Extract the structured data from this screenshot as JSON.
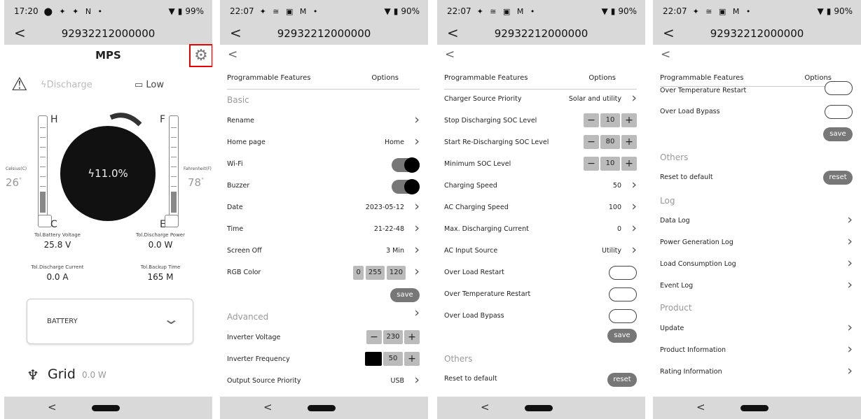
{
  "phone1": {
    "time": "17:20",
    "status_icons": "⬤ ✦ ✦ N •",
    "battery_pct": "99%",
    "title": "92932212000000",
    "heading": "MPS",
    "discharge_label": "Discharge",
    "battery_status": "Low",
    "gauge_left": {
      "top": "H",
      "bottom": "C",
      "unit": "Celsius(C)",
      "value": "26",
      "degree": "°"
    },
    "gauge_right": {
      "top": "F",
      "bottom": "E",
      "unit": "Fahrenheit(F)",
      "value": "78",
      "degree": "°"
    },
    "soc": "11.0%",
    "metrics": [
      {
        "label": "Tol.Battery Voltage",
        "value": "25.8 V"
      },
      {
        "label": "Tol.Discharge Power",
        "value": "0.0 W"
      },
      {
        "label": "Tol.Discharge Current",
        "value": "0.0 A"
      },
      {
        "label": "Tol.Backup Time",
        "value": "165 M"
      }
    ],
    "battery_select": "BATTERY",
    "grid_label": "Grid",
    "grid_value": "0.0 W"
  },
  "common": {
    "time": "22:07",
    "status_icons": "✦ ≅ ▣ M •",
    "battery_pct": "90%",
    "title": "92932212000000",
    "col_features": "Programmable Features",
    "col_options": "Options"
  },
  "phone2": {
    "section_basic": "Basic",
    "rename": "Rename",
    "home_page": "Home page",
    "home_page_value": "Home",
    "wifi": "Wi-Fi",
    "buzzer": "Buzzer",
    "date": "Date",
    "date_value": "2023-05-12",
    "time_label": "Time",
    "time_value": "21-22-48",
    "screen_off": "Screen Off",
    "screen_off_value": "3 Min",
    "rgb_color": "RGB Color",
    "rgb_r": "0",
    "rgb_g": "255",
    "rgb_b": "120",
    "save": "save",
    "section_advanced": "Advanced",
    "inverter_voltage": "Inverter Voltage",
    "inverter_voltage_value": "230",
    "inverter_frequency": "Inverter Frequency",
    "inverter_frequency_value": "50",
    "output_source_priority": "Output Source Priority",
    "output_source_priority_value": "USB"
  },
  "phone3": {
    "charger_source_priority": "Charger Source Priority",
    "charger_source_priority_value": "Solar and utility",
    "stop_discharging_soc": "Stop Discharging SOC Level",
    "stop_discharging_soc_value": "10",
    "start_redischarging_soc": "Start Re-Discharging SOC Level",
    "start_redischarging_soc_value": "80",
    "minimum_soc": "Minimum SOC Level",
    "minimum_soc_value": "10",
    "charging_speed": "Charging Speed",
    "charging_speed_value": "50",
    "ac_charging_speed": "AC Charging Speed",
    "ac_charging_speed_value": "100",
    "max_discharging_current": "Max. Discharging Current",
    "max_discharging_current_value": "0",
    "ac_input_source": "AC Input Source",
    "ac_input_source_value": "Utility",
    "over_load_restart": "Over Load Restart",
    "over_temp_restart": "Over Temperature Restart",
    "over_load_bypass": "Over Load Bypass",
    "save": "save",
    "section_others": "Others",
    "reset_to_default": "Reset to default",
    "reset": "reset"
  },
  "phone4": {
    "over_temp_restart": "Over Temperature Restart",
    "over_load_bypass": "Over Load Bypass",
    "save": "save",
    "section_others": "Others",
    "reset_to_default": "Reset to default",
    "reset": "reset",
    "section_log": "Log",
    "data_log": "Data Log",
    "power_generation_log": "Power Generation Log",
    "load_consumption_log": "Load Consumption Log",
    "event_log": "Event Log",
    "section_product": "Product",
    "update": "Update",
    "product_information": "Product Information",
    "rating_information": "Rating Information"
  },
  "icons": [
    "back-arrow-icon",
    "gear-icon",
    "warning-icon",
    "lightning-icon",
    "battery-icon",
    "chevron-right-icon",
    "chevron-down-icon",
    "transmission-tower-icon",
    "wifi-icon",
    "battery-status-icon"
  ],
  "colors": {
    "status_bar": "#d9d9d9",
    "highlight": "#e60000",
    "toggle": "#777777"
  }
}
